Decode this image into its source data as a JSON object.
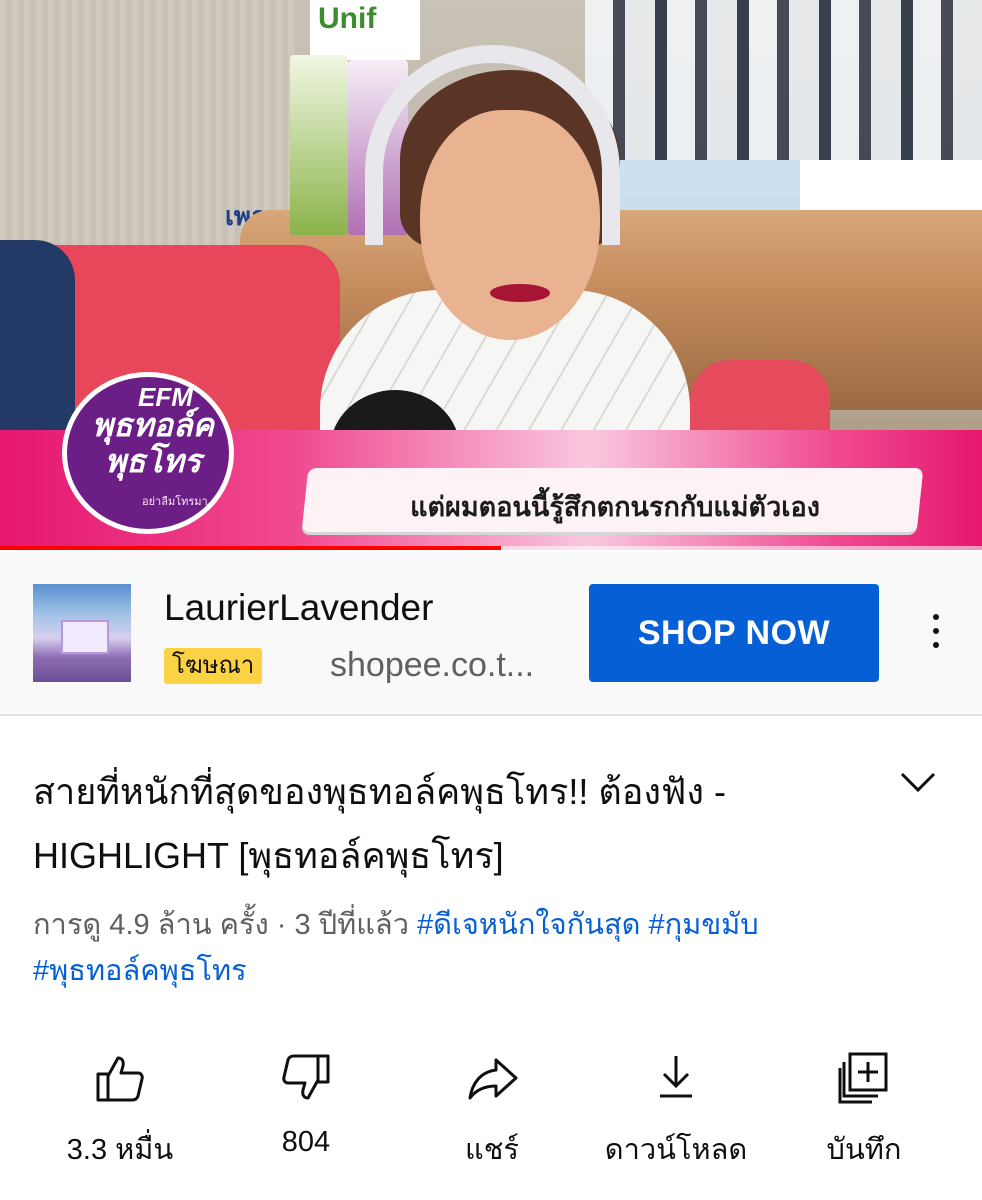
{
  "video": {
    "caption": "แต่ผมตอนนี้รู้สึกตกนรกกับแม่ตัวเอง",
    "screen_text": "เพลงเพราะ อ",
    "brand_sign": "Unif",
    "logo": {
      "station": "EFM",
      "line1": "พุธทอล์ค",
      "line2": "พุธโทร",
      "sub": "อย่าลืมโทรมา"
    },
    "progress_fraction": 0.51
  },
  "ad": {
    "advertiser": "LaurierLavender",
    "badge": "โฆษณา",
    "domain": "shopee.co.t...",
    "cta": "SHOP NOW"
  },
  "title": "สายที่หนักที่สุดของพุธทอล์คพุธโทร!! ต้องฟัง - HIGHLIGHT [พุธทอล์คพุธโทร]",
  "meta": {
    "views_time": "การดู 4.9 ล้าน ครั้ง · 3 ปีที่แล้ว",
    "hashtags": [
      "#ดีเจหนักใจกันสุด",
      "#กุมขมับ",
      "#พุธทอล์คพุธโทร"
    ]
  },
  "actions": {
    "like": "3.3 หมื่น",
    "dislike": "804",
    "share": "แชร์",
    "download": "ดาวน์โหลด",
    "save": "บันทึก"
  },
  "colors": {
    "accent_blue": "#065fd4",
    "progress_red": "#ff0000",
    "badge_yellow": "#fcd245"
  }
}
